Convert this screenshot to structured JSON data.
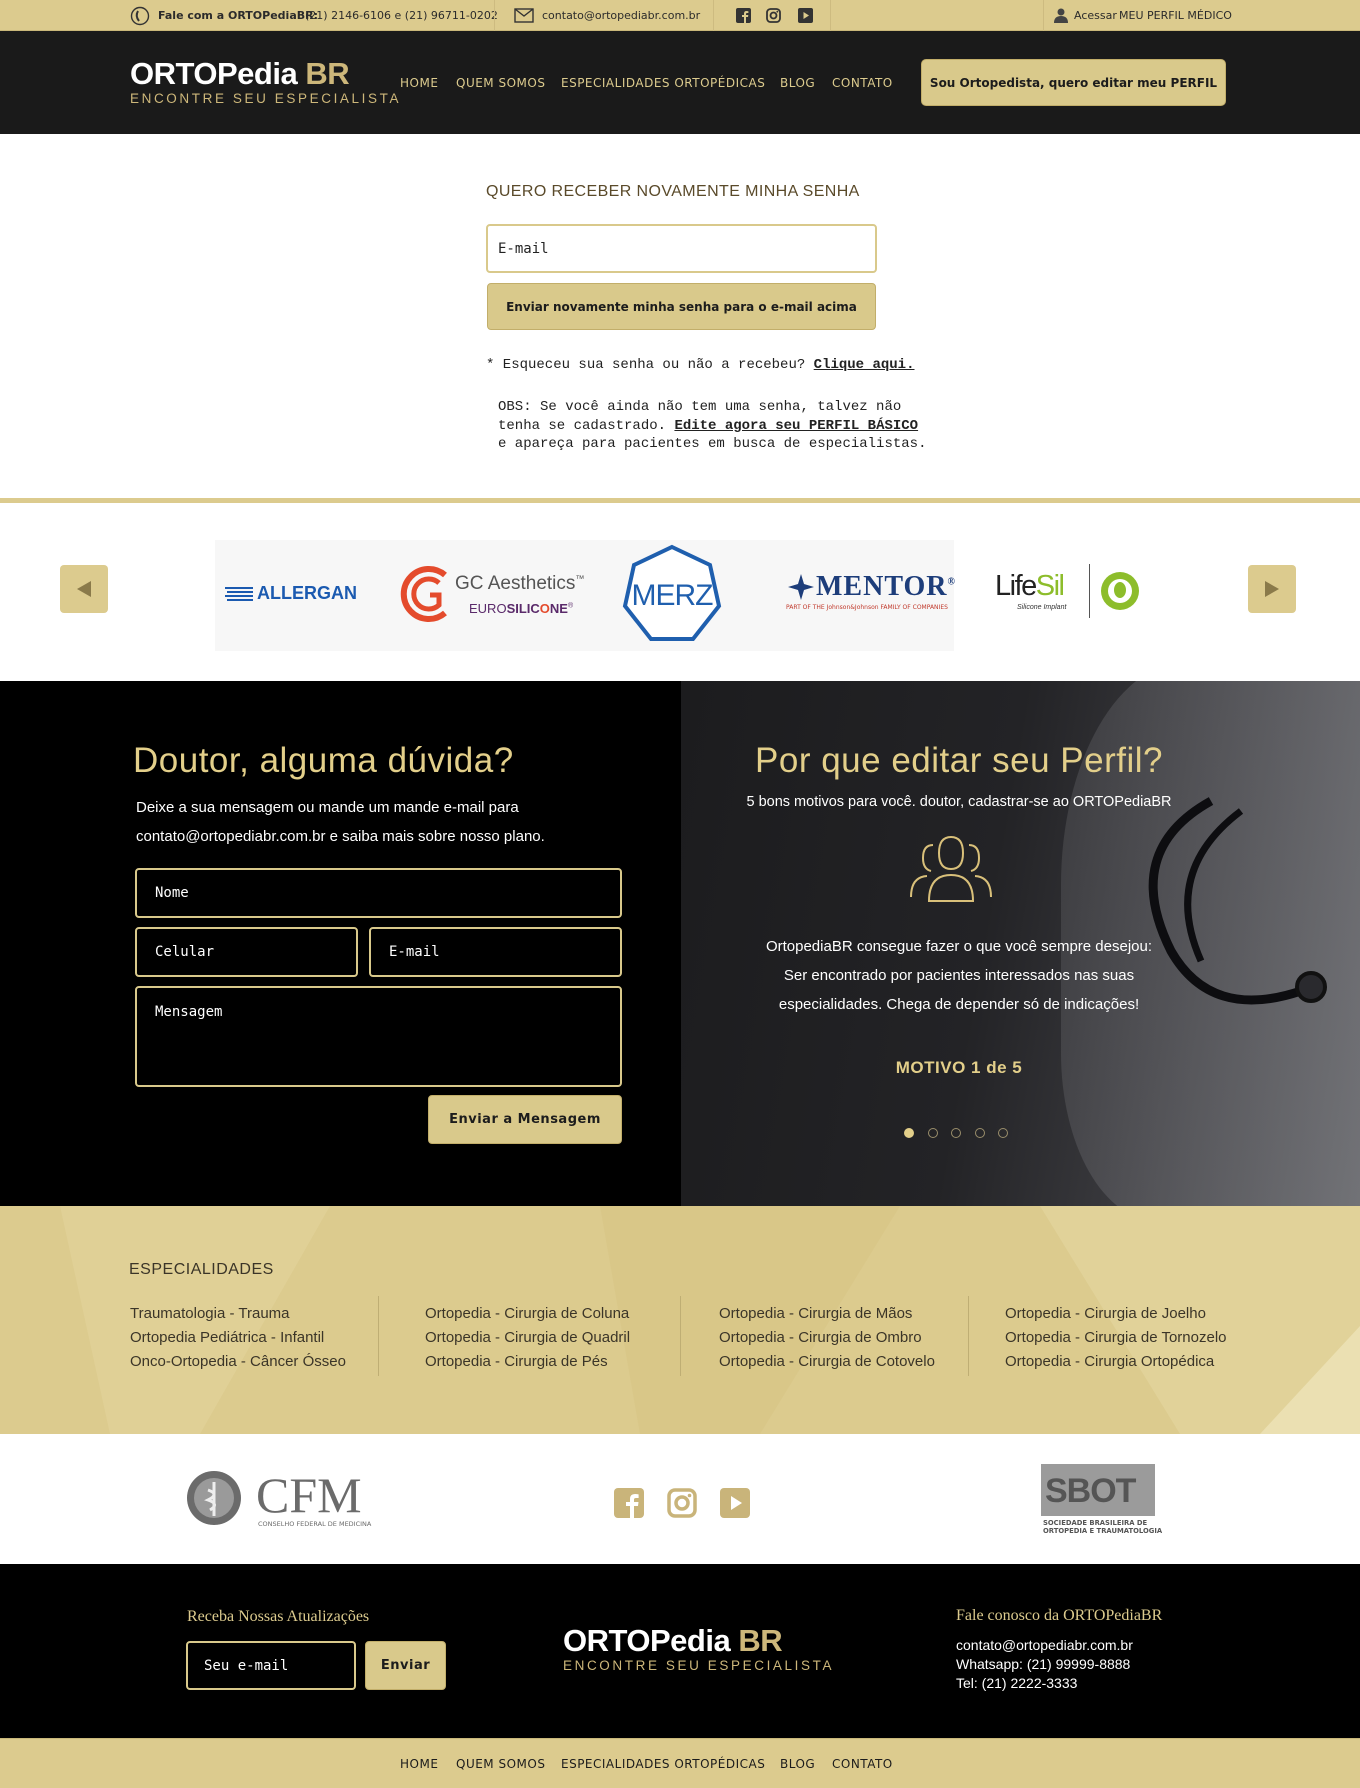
{
  "topbar": {
    "contact_label": "Fale com a ORTOPediaBR:",
    "phones": "(21) 2146-6106 e (21) 96711-0202",
    "email": "contato@ortopediabr.com.br",
    "access_label": "Acessar",
    "profile_label": "MEU PERFIL MÉDICO"
  },
  "brand": {
    "name_main": "ORTOPedia",
    "name_br": "BR",
    "tagline": "ENCONTRE  SEU  ESPECIALISTA"
  },
  "nav": [
    "HOME",
    "QUEM SOMOS",
    "ESPECIALIDADES ORTOPÉDICAS",
    "BLOG",
    "CONTATO"
  ],
  "header_cta": "Sou Ortopedista, quero editar meu PERFIL",
  "recover": {
    "title": "QUERO RECEBER NOVAMENTE MINHA SENHA",
    "email_placeholder": "E-mail",
    "submit": "Enviar novamente minha senha para o e-mail acima",
    "forgot_text": "* Esqueceu sua senha ou não a recebeu?",
    "forgot_link": "Clique aqui.",
    "obs_line1": "OBS: Se você ainda não tem uma senha, talvez não",
    "obs_line2a": "tenha se cadastrado.",
    "obs_link": "Edite agora seu PERFIL BÁSICO",
    "obs_line3": "e apareça para pacientes em busca de especialistas."
  },
  "partners": {
    "allergan": "ALLERGAN",
    "gc_top": "GC Aesthetics",
    "gc_tm": "™",
    "gc_bottom_a": "EURO",
    "gc_bottom_b": "SILIC",
    "gc_bottom_c": "NE",
    "gc_reg": "®",
    "merz": "MERZ",
    "mentor": "MENTOR",
    "mentor_reg": "®",
    "mentor_sub": "PART OF THE Johnson&Johnson FAMILY OF COMPANIES",
    "lifesil_a": "Life",
    "lifesil_b": "Sil",
    "lifesil_sub": "Silicone Implant"
  },
  "contact": {
    "title": "Doutor, alguma dúvida?",
    "line1": "Deixe a sua mensagem ou mande um mande e-mail para",
    "line2": "contato@ortopediabr.com.br e saiba mais sobre nosso plano.",
    "name_ph": "Nome",
    "phone_ph": "Celular",
    "email_ph": "E-mail",
    "msg_ph": "Mensagem",
    "submit": "Enviar a Mensagem"
  },
  "why": {
    "title": "Por que  editar seu Perfil?",
    "subtitle": "5 bons motivos para você. doutor, cadastrar-se ao ORTOPediaBR",
    "body1": "OrtopediaBR consegue fazer o que você sempre desejou:",
    "body2": "Ser encontrado por pacientes interessados nas suas",
    "body3": "especialidades. Chega de depender só de indicações!",
    "motivo": "MOTIVO 1 de 5",
    "slide_count": 5,
    "active_slide": 1
  },
  "specialties": {
    "title": "ESPECIALIDADES",
    "columns": [
      [
        "Traumatologia -  Trauma",
        "Ortopedia Pediátrica - Infantil",
        "Onco-Ortopedia - Câncer Ósseo"
      ],
      [
        "Ortopedia - Cirurgia de Coluna",
        "Ortopedia - Cirurgia de Quadril",
        "Ortopedia - Cirurgia de Pés"
      ],
      [
        "Ortopedia - Cirurgia de Mãos",
        "Ortopedia - Cirurgia de Ombro",
        "Ortopedia - Cirurgia de Cotovelo"
      ],
      [
        "Ortopedia - Cirurgia de Joelho",
        "Ortopedia - Cirurgia de Tornozelo",
        "Ortopedia - Cirurgia Ortopédica"
      ]
    ]
  },
  "institutions": {
    "cfm": "CFM",
    "cfm_sub": "CONSELHO FEDERAL DE MEDICINA",
    "sbot": "SBOT",
    "sbot_sub1": "SOCIEDADE BRASILEIRA DE",
    "sbot_sub2": "ORTOPEDIA E TRAUMATOLOGIA"
  },
  "footer": {
    "newsletter_title": "Receba Nossas Atualizações",
    "newsletter_ph": "Seu e-mail",
    "newsletter_btn": "Enviar",
    "contact_title": "Fale conosco da ORTOPediaBR",
    "email": "contato@ortopediabr.com.br",
    "whatsapp": "Whatsapp: (21) 99999-8888",
    "tel": "Tel: (21) 2222-3333"
  },
  "colors": {
    "gold": "#dccb8e",
    "dark": "#1a1a1a",
    "black": "#000000",
    "text_gold": "#e3cf8a"
  }
}
